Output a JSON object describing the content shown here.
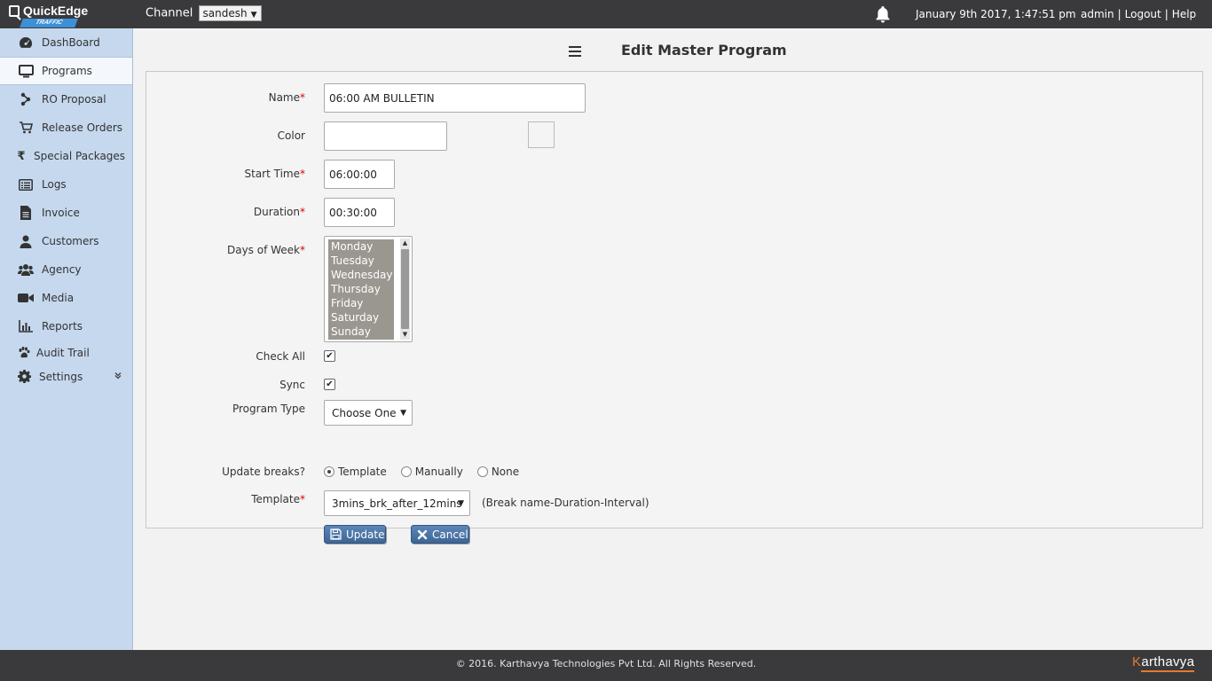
{
  "app": {
    "logo_text": "QuickEdge",
    "logo_sub": "TRAFFIC",
    "channel_label": "Channel",
    "channel_value": "sandesh",
    "datetime": "January 9th 2017, 1:47:51 pm",
    "user": "admin",
    "logout": "Logout",
    "help": "Help",
    "sep": "|"
  },
  "sidebar": {
    "items": [
      {
        "label": "DashBoard",
        "icon": "dashboard-icon"
      },
      {
        "label": "Programs",
        "icon": "monitor-icon"
      },
      {
        "label": "RO Proposal",
        "icon": "ro-proposal-icon"
      },
      {
        "label": "Release Orders",
        "icon": "cart-icon"
      },
      {
        "label": "Special Packages",
        "icon": "rupee-icon"
      },
      {
        "label": "Logs",
        "icon": "list-icon"
      },
      {
        "label": "Invoice",
        "icon": "document-icon"
      },
      {
        "label": "Customers",
        "icon": "user-icon"
      },
      {
        "label": "Agency",
        "icon": "users-icon"
      },
      {
        "label": "Media",
        "icon": "video-camera-icon"
      },
      {
        "label": "Reports",
        "icon": "bar-chart-icon"
      },
      {
        "label": "Audit Trail",
        "icon": "paw-icon"
      },
      {
        "label": "Settings",
        "icon": "gear-icon"
      }
    ]
  },
  "page": {
    "title": "Edit Master Program"
  },
  "form": {
    "name_label": "Name",
    "name_value": "06:00 AM BULLETIN",
    "color_label": "Color",
    "color_value": "",
    "start_label": "Start Time",
    "start_value": "06:00:00",
    "duration_label": "Duration",
    "duration_value": "00:30:00",
    "days_label": "Days of Week",
    "days": [
      "Monday",
      "Tuesday",
      "Wednesday",
      "Thursday",
      "Friday",
      "Saturday",
      "Sunday"
    ],
    "check_all_label": "Check All",
    "check_all_checked": true,
    "sync_label": "Sync",
    "sync_checked": true,
    "program_type_label": "Program Type",
    "program_type_value": "Choose One",
    "update_breaks_label": "Update breaks?",
    "update_breaks_options": [
      "Template",
      "Manually",
      "None"
    ],
    "update_breaks_selected": "Template",
    "template_label": "Template",
    "template_value": "3mins_brk_after_12mins",
    "template_hint": "(Break name-Duration-Interval)",
    "required_mark": "*",
    "update_button": "Update",
    "cancel_button": "Cancel"
  },
  "footer": {
    "copyright": "© 2016. Karthavya Technologies Pvt Ltd. All Rights Reserved.",
    "brand_first": "K",
    "brand_rest": "arthavya"
  }
}
